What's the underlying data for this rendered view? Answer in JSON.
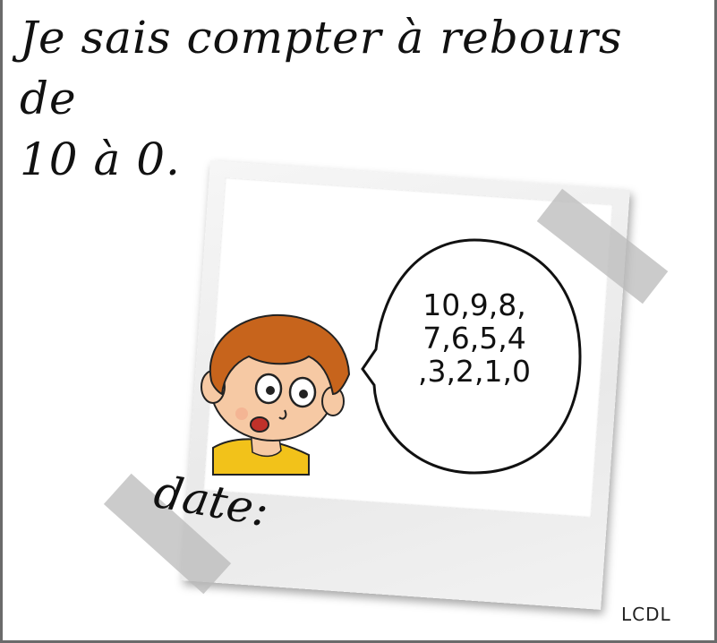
{
  "title": {
    "line1": "Je sais compter à rebours de",
    "line2": "10 à 0."
  },
  "bubble": {
    "text": "10,9,8,\n7,6,5,4\n,3,2,1,0"
  },
  "date_label": "date:",
  "credit": "LCDL",
  "colors": {
    "hair": "#c7641c",
    "skin": "#f6c9a4",
    "shirt": "#f2c21a",
    "tape": "#b9b9b9",
    "border": "#6b6b6b"
  }
}
